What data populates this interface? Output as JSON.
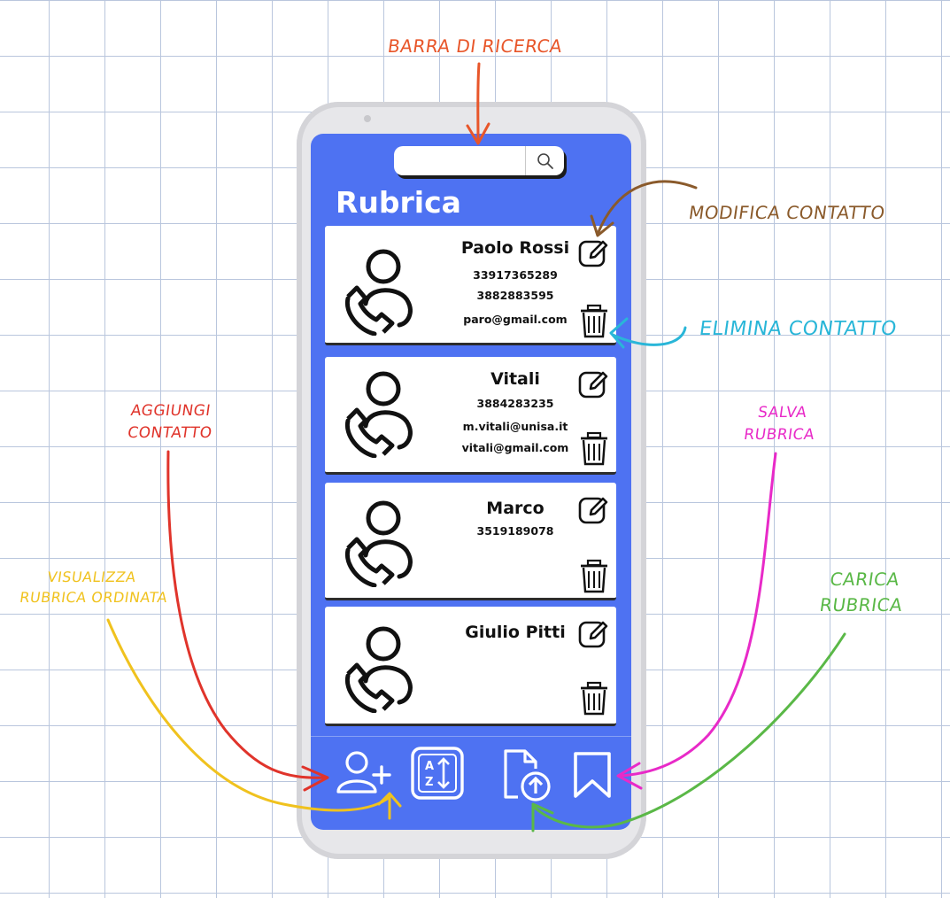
{
  "app": {
    "title": "Rubrica"
  },
  "search": {
    "placeholder": ""
  },
  "contacts": [
    {
      "name": "Paolo Rossi",
      "lines": [
        "33917365289",
        "3882883595",
        "paro@gmail.com"
      ]
    },
    {
      "name": "Vitali",
      "lines": [
        "3884283235",
        "m.vitali@unisa.it",
        "vitali@gmail.com"
      ]
    },
    {
      "name": "Marco",
      "lines": [
        "3519189078"
      ]
    },
    {
      "name": "Giulio Pitti",
      "lines": []
    }
  ],
  "bottom_bar": {
    "icons": [
      "add-user-icon",
      "sort-az-icon",
      "upload-file-icon",
      "bookmark-icon"
    ]
  },
  "annotations": {
    "search_bar": {
      "text": "BARRA DI RICERCA",
      "color": "#e8562a"
    },
    "edit_contact": {
      "text": "MODIFICA CONTATTO",
      "color": "#8a5a2b"
    },
    "delete_contact": {
      "text": "ELIMINA CONTATTO",
      "color": "#29b6d8"
    },
    "add_contact": {
      "line1": "AGGIUNGI",
      "line2": "CONTATTO",
      "color": "#e0342b"
    },
    "sorted_view": {
      "line1": "VISUALIZZA",
      "line2": "RUBRICA ORDINATA",
      "color": "#f0c21e"
    },
    "save_book": {
      "line1": "SALVA",
      "line2": "RUBRICA",
      "color": "#e82ac8"
    },
    "load_book": {
      "line1": "CARICA",
      "line2": "RUBRICA",
      "color": "#5ab847"
    }
  }
}
